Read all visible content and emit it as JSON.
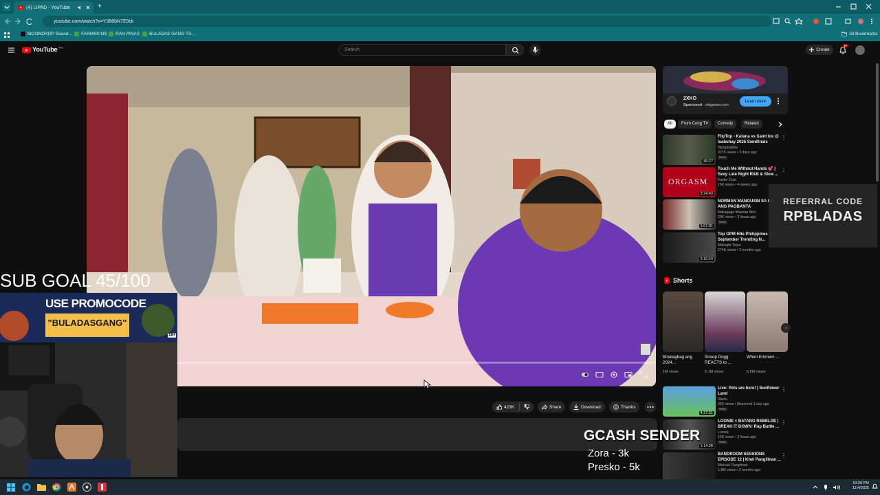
{
  "browser": {
    "tab_title": "(4) LIPAD - YouTube",
    "url": "youtube.com/watch?v=Y386bN7E9ck",
    "bookmarks": [
      "MOONDROP Sound...",
      "FARMSKINS",
      "RAN PINAS",
      "BULADAS GANG TS..."
    ],
    "all_bookmarks": "All Bookmarks"
  },
  "youtube": {
    "logo_text": "YouTube",
    "logo_region": "PH",
    "search_placeholder": "Search",
    "create_label": "Create",
    "notif_count": "9+"
  },
  "actions": {
    "likes": "423K",
    "share": "Share",
    "download": "Download",
    "thanks": "Thanks"
  },
  "ad": {
    "title": "2XKO",
    "sponsored": "Sponsored",
    "domain": "riotgames.com",
    "cta": "Learn more"
  },
  "chips": [
    "All",
    "From Cong TV",
    "Comedy",
    "Related"
  ],
  "videos": [
    {
      "title": "FlipTop - Katana vs Saint Ice @ Isabuhay 2025 Semifinals",
      "channel": "fliptopbattles",
      "meta": "927K views • 3 days ago",
      "badge": "New",
      "duration": "46:27"
    },
    {
      "title": "Touch Me Without Hands 💕 | Sexy Late Night R&B & Slow ...",
      "channel": "Faster Dust",
      "meta": "15K views • 4 weeks ago",
      "badge": "",
      "duration": "3:24:43"
    },
    {
      "title": "NORMAN MANGUSIN SA NA ANG PAGBANTA",
      "channel": "Makagago Wazzup Men",
      "meta": "29K views • 3 hours ago",
      "badge": "New",
      "duration": "1:07:01"
    },
    {
      "title": "Top OPM Hits Philippines 🎵 September Trending N...",
      "channel": "Midnight Tears",
      "meta": "274K views • 2 months ago",
      "badge": "",
      "duration": "2:10:14"
    }
  ],
  "shorts": {
    "heading": "Shorts",
    "items": [
      {
        "title": "Binalagbag ang 2024...",
        "views": "1M views"
      },
      {
        "title": "Snoop Dogg REACTS to ...",
        "views": "5.1M views"
      },
      {
        "title": "When Eminem ...",
        "views": "5.6M views"
      }
    ]
  },
  "videos2": [
    {
      "title": "Live: Pets are here! | Sunflower Land",
      "channel": "Naofu",
      "meta": "260 views • Streamed 1 day ago",
      "badge": "New",
      "duration": "4:27:51"
    },
    {
      "title": "LOONIE × BATANG REBELDE | BREAK IT DOWN: Rap Battle ...",
      "channel": "Loonie",
      "meta": "15K views • 3 hours ago",
      "badge": "New",
      "duration": "1:14:28"
    },
    {
      "title": "BANDROOM SESSIONS EPISODE 12 | Khel Pangilinan ...",
      "channel": "Michael Pangilinan",
      "meta": "1.8M views • 3 months ago",
      "badge": "",
      "duration": ""
    }
  ],
  "overlay": {
    "sub_goal": "SUB GOAL 45/100",
    "promo_line1": "USE PROMOCODE",
    "promo_line2": "\"BULADASGANG\"",
    "promo_age": "18+",
    "gcash_title": "GCASH SENDER",
    "donors": [
      "Zora - 3k",
      "Presko - 5k"
    ],
    "referral_label": "REFERRAL CODE",
    "referral_code": "RPBLADAS"
  },
  "taskbar": {
    "time": "10:26 PM",
    "date": "11/4/2025"
  }
}
